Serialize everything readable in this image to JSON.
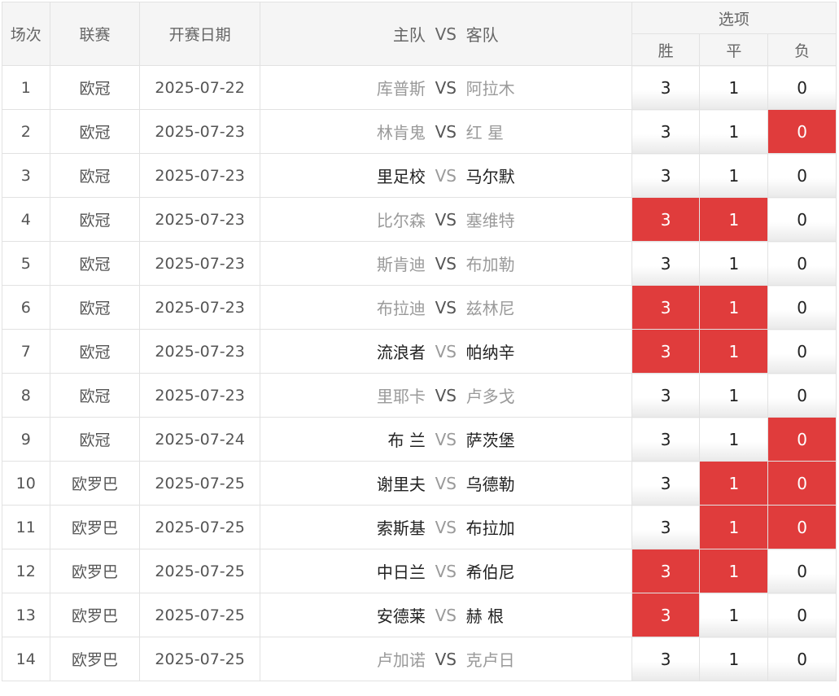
{
  "header": {
    "idx": "场次",
    "league": "联赛",
    "date": "开赛日期",
    "home": "主队",
    "vs": "VS",
    "away": "客队",
    "options": "选项",
    "win": "胜",
    "draw": "平",
    "lose": "负"
  },
  "colors": {
    "selected": "#e03c3c",
    "grey_text": "#9a9a9a",
    "dark_text": "#222222"
  },
  "rows": [
    {
      "idx": "1",
      "league": "欧冠",
      "date": "2025-07-22",
      "home": "库普斯",
      "away": "阿拉木",
      "highlight": "none",
      "win": "3",
      "draw": "1",
      "lose": "0",
      "win_sel": false,
      "draw_sel": false,
      "lose_sel": false
    },
    {
      "idx": "2",
      "league": "欧冠",
      "date": "2025-07-23",
      "home": "林肯鬼",
      "away": "红 星",
      "highlight": "none",
      "win": "3",
      "draw": "1",
      "lose": "0",
      "win_sel": false,
      "draw_sel": false,
      "lose_sel": true
    },
    {
      "idx": "3",
      "league": "欧冠",
      "date": "2025-07-23",
      "home": "里足校",
      "away": "马尔默",
      "highlight": "both",
      "win": "3",
      "draw": "1",
      "lose": "0",
      "win_sel": false,
      "draw_sel": false,
      "lose_sel": false
    },
    {
      "idx": "4",
      "league": "欧冠",
      "date": "2025-07-23",
      "home": "比尔森",
      "away": "塞维特",
      "highlight": "none",
      "win": "3",
      "draw": "1",
      "lose": "0",
      "win_sel": true,
      "draw_sel": true,
      "lose_sel": false
    },
    {
      "idx": "5",
      "league": "欧冠",
      "date": "2025-07-23",
      "home": "斯肯迪",
      "away": "布加勒",
      "highlight": "none",
      "win": "3",
      "draw": "1",
      "lose": "0",
      "win_sel": false,
      "draw_sel": false,
      "lose_sel": false
    },
    {
      "idx": "6",
      "league": "欧冠",
      "date": "2025-07-23",
      "home": "布拉迪",
      "away": "兹林尼",
      "highlight": "none",
      "win": "3",
      "draw": "1",
      "lose": "0",
      "win_sel": true,
      "draw_sel": true,
      "lose_sel": false
    },
    {
      "idx": "7",
      "league": "欧冠",
      "date": "2025-07-23",
      "home": "流浪者",
      "away": "帕纳辛",
      "highlight": "both",
      "win": "3",
      "draw": "1",
      "lose": "0",
      "win_sel": true,
      "draw_sel": true,
      "lose_sel": false
    },
    {
      "idx": "8",
      "league": "欧冠",
      "date": "2025-07-23",
      "home": "里耶卡",
      "away": "卢多戈",
      "highlight": "none",
      "win": "3",
      "draw": "1",
      "lose": "0",
      "win_sel": false,
      "draw_sel": false,
      "lose_sel": false
    },
    {
      "idx": "9",
      "league": "欧冠",
      "date": "2025-07-24",
      "home": "布 兰",
      "away": "萨茨堡",
      "highlight": "both",
      "win": "3",
      "draw": "1",
      "lose": "0",
      "win_sel": false,
      "draw_sel": false,
      "lose_sel": true
    },
    {
      "idx": "10",
      "league": "欧罗巴",
      "date": "2025-07-25",
      "home": "谢里夫",
      "away": "乌德勒",
      "highlight": "both",
      "win": "3",
      "draw": "1",
      "lose": "0",
      "win_sel": false,
      "draw_sel": true,
      "lose_sel": true
    },
    {
      "idx": "11",
      "league": "欧罗巴",
      "date": "2025-07-25",
      "home": "索斯基",
      "away": "布拉加",
      "highlight": "both",
      "win": "3",
      "draw": "1",
      "lose": "0",
      "win_sel": false,
      "draw_sel": true,
      "lose_sel": true
    },
    {
      "idx": "12",
      "league": "欧罗巴",
      "date": "2025-07-25",
      "home": "中日兰",
      "away": "希伯尼",
      "highlight": "both",
      "win": "3",
      "draw": "1",
      "lose": "0",
      "win_sel": true,
      "draw_sel": true,
      "lose_sel": false
    },
    {
      "idx": "13",
      "league": "欧罗巴",
      "date": "2025-07-25",
      "home": "安德莱",
      "away": "赫 根",
      "highlight": "both",
      "win": "3",
      "draw": "1",
      "lose": "0",
      "win_sel": true,
      "draw_sel": false,
      "lose_sel": false
    },
    {
      "idx": "14",
      "league": "欧罗巴",
      "date": "2025-07-25",
      "home": "卢加诺",
      "away": "克卢日",
      "highlight": "none",
      "win": "3",
      "draw": "1",
      "lose": "0",
      "win_sel": false,
      "draw_sel": false,
      "lose_sel": false
    }
  ]
}
